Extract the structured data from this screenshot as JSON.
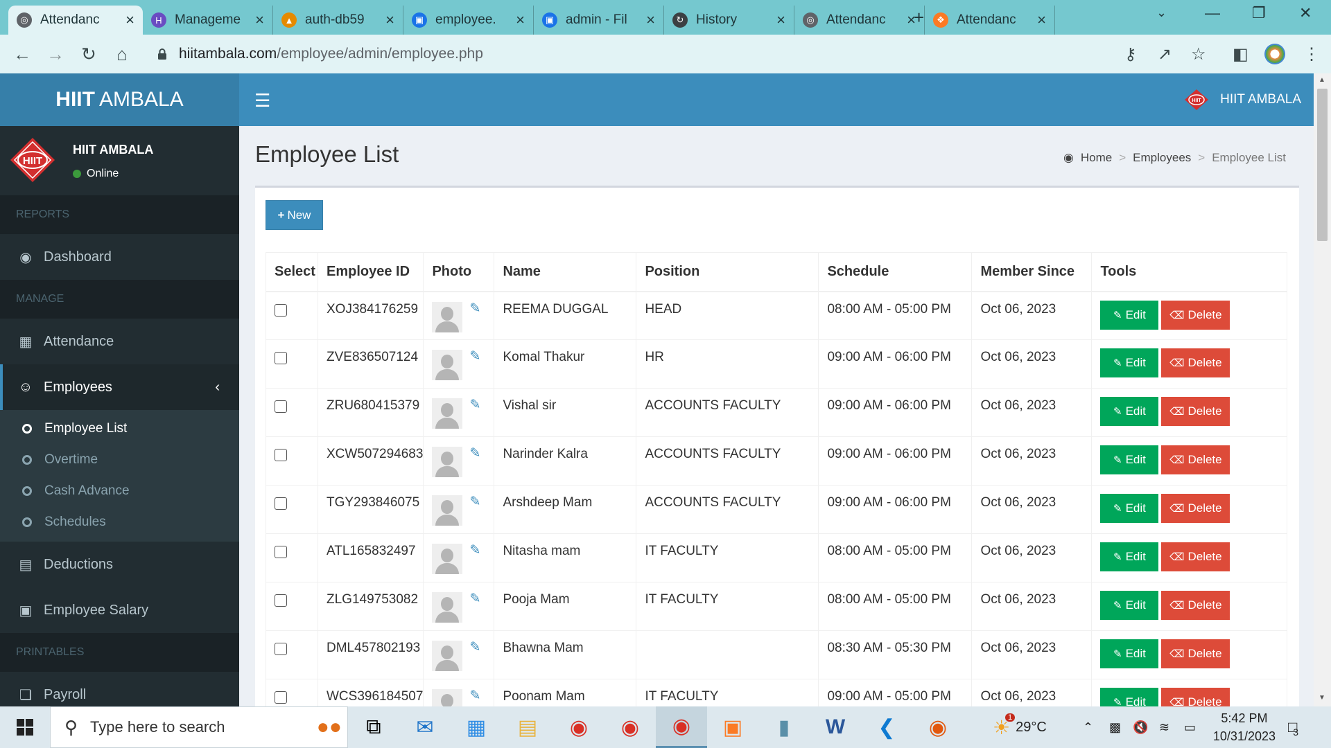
{
  "browser": {
    "tabs": [
      {
        "title": "Attendanc",
        "icon": "globe-icon",
        "color": "#5f6368",
        "active": true
      },
      {
        "title": "Manageme",
        "icon": "h-logo-icon",
        "color": "#6a4cc2",
        "active": false
      },
      {
        "title": "auth-db59",
        "icon": "phpmyadmin-icon",
        "color": "#e58a00",
        "active": false
      },
      {
        "title": "employee.",
        "icon": "chrome-file-icon",
        "color": "#1a73e8",
        "active": false
      },
      {
        "title": "admin - Fil",
        "icon": "chrome-file-icon",
        "color": "#1a73e8",
        "active": false
      },
      {
        "title": "History",
        "icon": "history-icon",
        "color": "#3c4043",
        "active": false
      },
      {
        "title": "Attendanc",
        "icon": "globe-icon",
        "color": "#5f6368",
        "active": false
      },
      {
        "title": "Attendanc",
        "icon": "xampp-icon",
        "color": "#fb7a24",
        "active": false
      }
    ],
    "url_domain": "hiitambala.com",
    "url_path": "/employee/admin/employee.php"
  },
  "header": {
    "logo_bold": "HIIT",
    "logo_rest": "AMBALA",
    "user_name": "HIIT AMBALA",
    "brand_color": "#3c8dbc"
  },
  "sidebar": {
    "user_name": "HIIT AMBALA",
    "status": "Online",
    "sections": {
      "reports": "REPORTS",
      "manage": "MANAGE",
      "printables": "PRINTABLES"
    },
    "items": {
      "dashboard": "Dashboard",
      "attendance": "Attendance",
      "employees": "Employees",
      "deductions": "Deductions",
      "employee_salary": "Employee Salary",
      "payroll": "Payroll"
    },
    "submenu": {
      "employee_list": "Employee List",
      "overtime": "Overtime",
      "cash_advance": "Cash Advance",
      "schedules": "Schedules"
    }
  },
  "main": {
    "title": "Employee List",
    "breadcrumb": [
      "Home",
      "Employees",
      "Employee List"
    ],
    "new_button": "New",
    "columns": [
      "Select",
      "Employee ID",
      "Photo",
      "Name",
      "Position",
      "Schedule",
      "Member Since",
      "Tools"
    ],
    "edit_label": "Edit",
    "delete_label": "Delete",
    "rows": [
      {
        "id": "XOJ384176259",
        "name": "REEMA DUGGAL",
        "position": "HEAD",
        "schedule": "08:00 AM - 05:00 PM",
        "since": "Oct 06, 2023"
      },
      {
        "id": "ZVE836507124",
        "name": "Komal Thakur",
        "position": "HR",
        "schedule": "09:00 AM - 06:00 PM",
        "since": "Oct 06, 2023"
      },
      {
        "id": "ZRU680415379",
        "name": "Vishal sir",
        "position": "ACCOUNTS FACULTY",
        "schedule": "09:00 AM - 06:00 PM",
        "since": "Oct 06, 2023"
      },
      {
        "id": "XCW507294683",
        "name": "Narinder Kalra",
        "position": "ACCOUNTS FACULTY",
        "schedule": "09:00 AM - 06:00 PM",
        "since": "Oct 06, 2023"
      },
      {
        "id": "TGY293846075",
        "name": "Arshdeep Mam",
        "position": "ACCOUNTS FACULTY",
        "schedule": "09:00 AM - 06:00 PM",
        "since": "Oct 06, 2023"
      },
      {
        "id": "ATL165832497",
        "name": "Nitasha mam",
        "position": "IT FACULTY",
        "schedule": "08:00 AM - 05:00 PM",
        "since": "Oct 06, 2023"
      },
      {
        "id": "ZLG149753082",
        "name": "Pooja Mam",
        "position": "IT FACULTY",
        "schedule": "08:00 AM - 05:00 PM",
        "since": "Oct 06, 2023"
      },
      {
        "id": "DML457802193",
        "name": "Bhawna Mam",
        "position": "",
        "schedule": "08:30 AM - 05:30 PM",
        "since": "Oct 06, 2023"
      },
      {
        "id": "WCS396184507",
        "name": "Poonam Mam",
        "position": "IT FACULTY",
        "schedule": "09:00 AM - 05:00 PM",
        "since": "Oct 06, 2023"
      }
    ]
  },
  "taskbar": {
    "search_placeholder": "Type here to search",
    "weather": "29°C",
    "time": "5:42 PM",
    "date": "10/31/2023",
    "notification_count": "3",
    "weather_badge": "1"
  }
}
